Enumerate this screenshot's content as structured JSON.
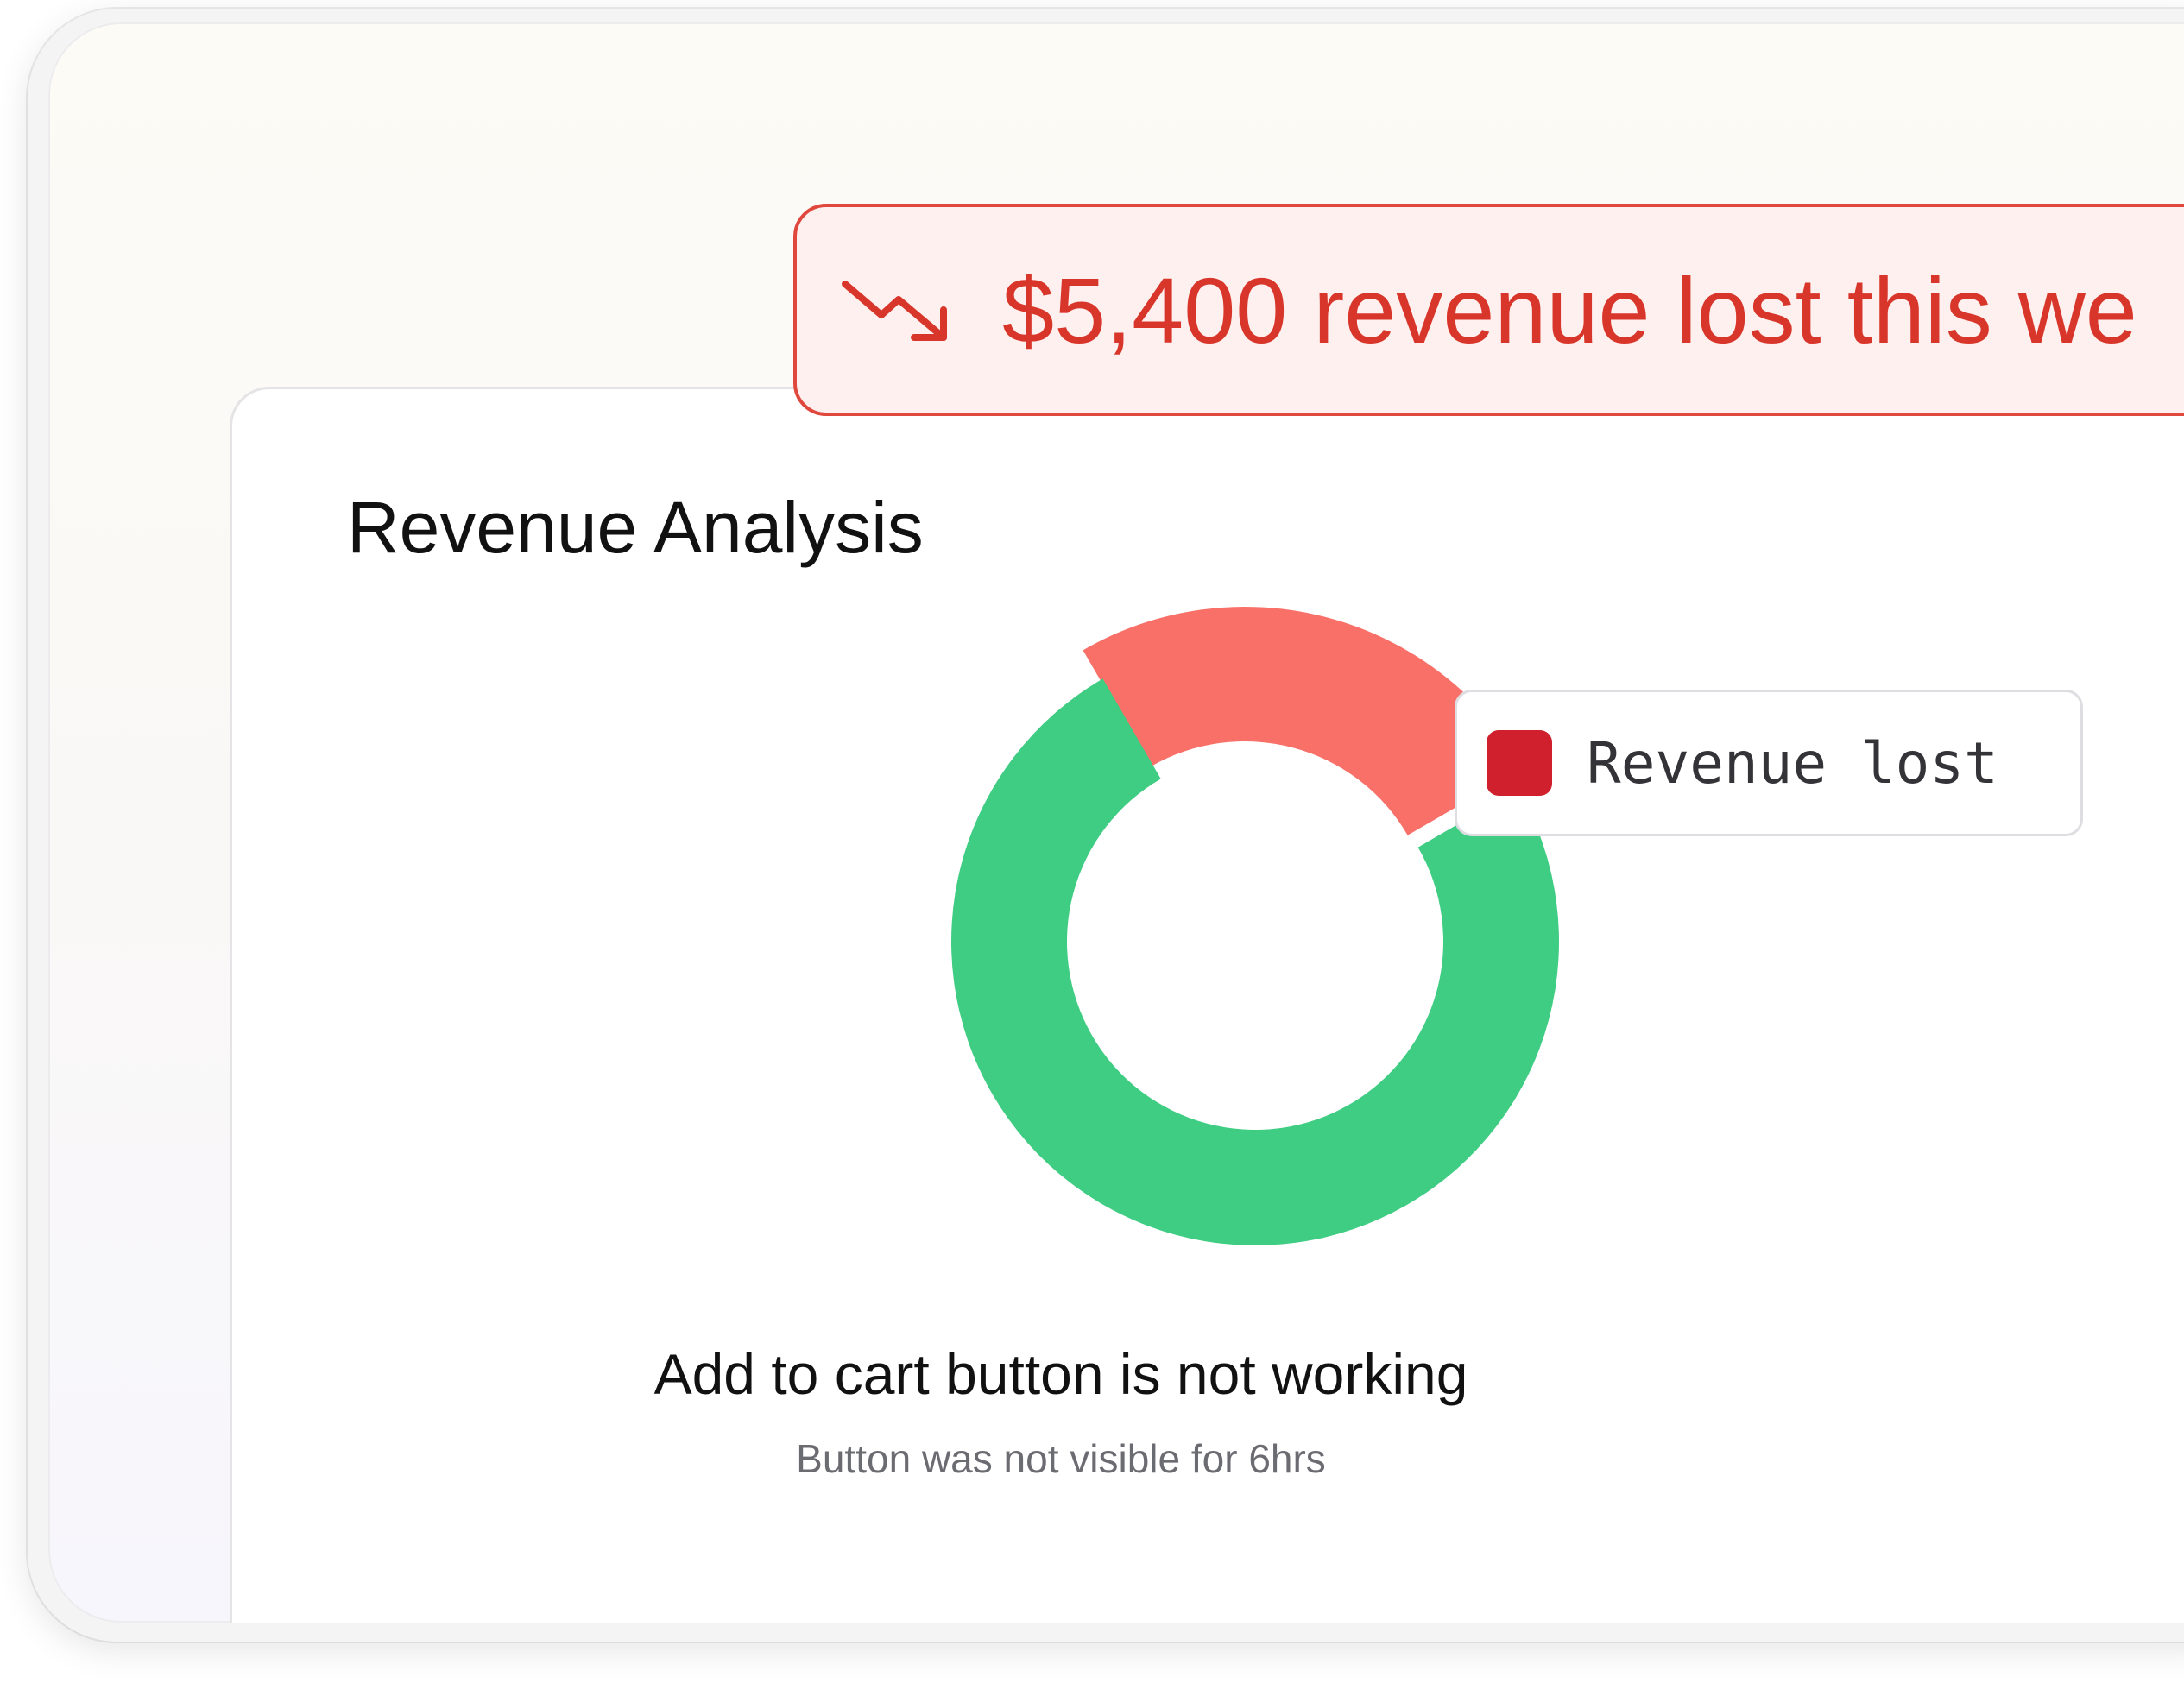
{
  "alert": {
    "icon": "trending-down-icon",
    "text": "$5,400 revenue lost this we",
    "color": "#d9362b"
  },
  "card": {
    "title": "Revenue Analysis"
  },
  "chart_data": {
    "type": "pie",
    "style": "donut",
    "slices": [
      {
        "label": "Revenue lost",
        "value": 25,
        "color": "#f87068"
      },
      {
        "label": "",
        "value": 75,
        "color": "#3fcc83"
      }
    ],
    "legend": [
      {
        "label": "Revenue lost",
        "color": "#d0202e"
      }
    ],
    "legend_position": "right",
    "highlighted": "Revenue lost"
  },
  "issue": {
    "title": "Add to cart button is not working",
    "subtitle": "Button was not visible for 6hrs"
  }
}
